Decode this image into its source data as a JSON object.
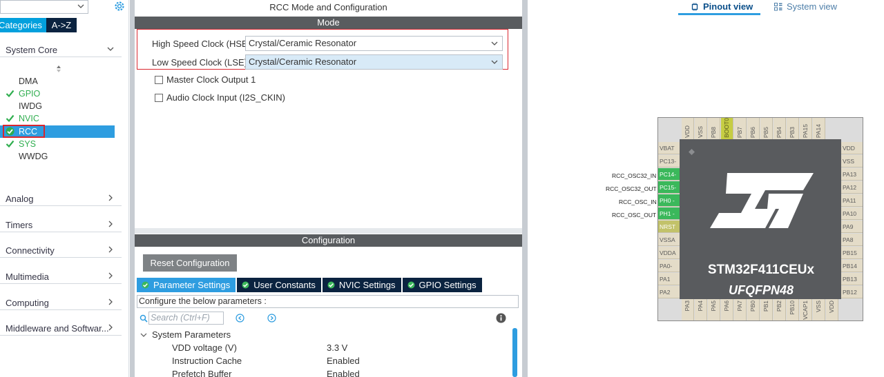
{
  "left": {
    "tabs": {
      "categories": "Categories",
      "az": "A->Z"
    },
    "system_core": {
      "label": "System Core",
      "items": [
        {
          "label": "DMA",
          "checked": false
        },
        {
          "label": "GPIO",
          "checked": true
        },
        {
          "label": "IWDG",
          "checked": false
        },
        {
          "label": "NVIC",
          "checked": true
        },
        {
          "label": "RCC",
          "checked": true,
          "selected": true
        },
        {
          "label": "SYS",
          "checked": true
        },
        {
          "label": "WWDG",
          "checked": false
        }
      ]
    },
    "categories": [
      "Analog",
      "Timers",
      "Connectivity",
      "Multimedia",
      "Computing",
      "Middleware and Softwar..."
    ]
  },
  "middle": {
    "title": "RCC Mode and Configuration",
    "mode_header": "Mode",
    "hse": {
      "label": "High Speed Clock (HSE)",
      "value": "Crystal/Ceramic Resonator"
    },
    "lse": {
      "label": "Low Speed Clock (LSE)",
      "value": "Crystal/Ceramic Resonator"
    },
    "checkboxes": [
      {
        "label": "Master Clock Output 1",
        "checked": false
      },
      {
        "label": "Audio Clock Input (I2S_CKIN)",
        "checked": false
      }
    ],
    "config_header": "Configuration",
    "reset_button": "Reset Configuration",
    "param_tabs": [
      "Parameter Settings",
      "User Constants",
      "NVIC Settings",
      "GPIO Settings"
    ],
    "configure_text": "Configure the below parameters :",
    "search_placeholder": "Search (Ctrl+F)",
    "group": "System Parameters",
    "params": [
      {
        "name": "VDD voltage (V)",
        "value": "3.3 V"
      },
      {
        "name": "Instruction Cache",
        "value": "Enabled"
      },
      {
        "name": "Prefetch Buffer",
        "value": "Enabled"
      }
    ]
  },
  "right": {
    "view_tabs": {
      "pinout": "Pinout view",
      "system": "System view"
    },
    "chip_name": "STM32F411CEUx",
    "package": "UFQFPN48",
    "top_pins": [
      "VDD",
      "VSS",
      "PB8",
      "BOOT0",
      "PB7",
      "PB6",
      "PB5",
      "PB4",
      "PB3",
      "PA15",
      "PA14"
    ],
    "bottom_pins": [
      "PA3",
      "PA4",
      "PA5",
      "PA6",
      "PA7",
      "PB0",
      "PB1",
      "PB2",
      "PB10",
      "VCAP1",
      "VSS",
      "VDD"
    ],
    "left_pins": [
      "VBAT",
      "PC13-",
      "PC14-",
      "PC15-",
      "PH0 -",
      "PH1 -",
      "NRST",
      "VSSA",
      "VDDA",
      "PA0-",
      "PA1",
      "PA2"
    ],
    "right_pins": [
      "VDD",
      "VSS",
      "PA13",
      "PA12",
      "PA11",
      "PA10",
      "PA9",
      "PA8",
      "PB15",
      "PB14",
      "PB13",
      "PB12"
    ],
    "signals": [
      "RCC_OSC32_IN",
      "RCC_OSC32_OUT",
      "RCC_OSC_IN",
      "RCC_OSC_OUT"
    ]
  },
  "colors": {
    "accent": "#2e9de0",
    "navy": "#0b2340",
    "highlight_red": "#d9262e",
    "enabled_green": "#2fae4f",
    "pin_green": "#3bb85b"
  }
}
